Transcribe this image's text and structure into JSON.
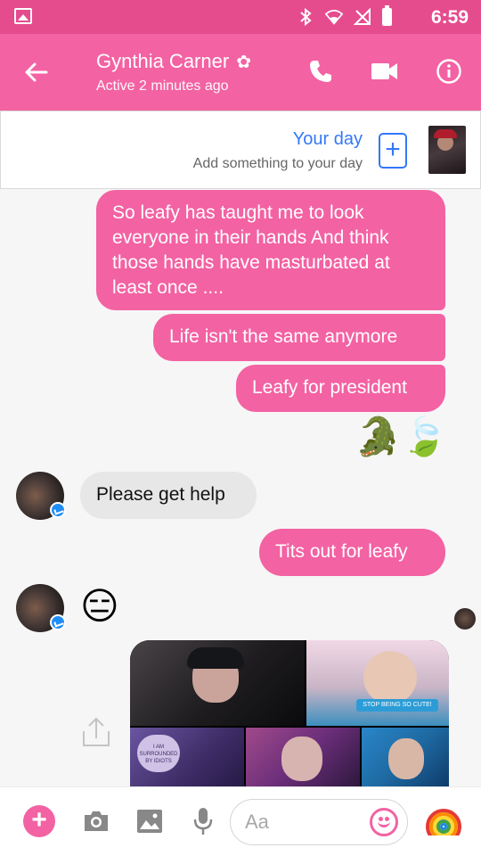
{
  "status_bar": {
    "time": "6:59",
    "icons": [
      "gallery-icon",
      "bluetooth-icon",
      "wifi-icon",
      "no-signal-icon",
      "battery-icon"
    ]
  },
  "header": {
    "contact_name": "Gynthia Carner",
    "contact_status": "Active 2 minutes ago",
    "icons": [
      "back-arrow-icon",
      "flower-icon",
      "phone-icon",
      "video-camera-icon",
      "info-icon"
    ],
    "accent_color": "#f362a3",
    "status_bar_color": "#e54c8e"
  },
  "your_day": {
    "title": "Your day",
    "subtitle": "Add something to your day"
  },
  "messages": [
    {
      "direction": "out",
      "type": "text",
      "text": "So leafy has taught me to look everyone in their hands And think those hands have masturbated at least once ...."
    },
    {
      "direction": "out",
      "type": "text",
      "text": "Life isn't the same anymore"
    },
    {
      "direction": "out",
      "type": "text",
      "text": "Leafy for president"
    },
    {
      "direction": "out",
      "type": "emoji",
      "text": "🐊🍃"
    },
    {
      "direction": "in",
      "type": "text",
      "text": "Please get help"
    },
    {
      "direction": "out",
      "type": "text",
      "text": "Tits out for leafy"
    },
    {
      "direction": "in",
      "type": "emoji",
      "text": "😑"
    },
    {
      "direction": "in",
      "type": "image",
      "description_labels": [
        "STOP BEING SO CUTE!",
        "I AM SURROUNDED BY IDIOTS"
      ]
    }
  ],
  "composer": {
    "placeholder": "Aa",
    "icons": [
      "plus-icon",
      "camera-icon",
      "image-icon",
      "microphone-icon",
      "emoji-icon",
      "rainbow-icon"
    ]
  },
  "colors": {
    "outgoing_bubble": "#f362a3",
    "incoming_bubble": "#e7e7e7",
    "link_blue": "#3478f6"
  }
}
